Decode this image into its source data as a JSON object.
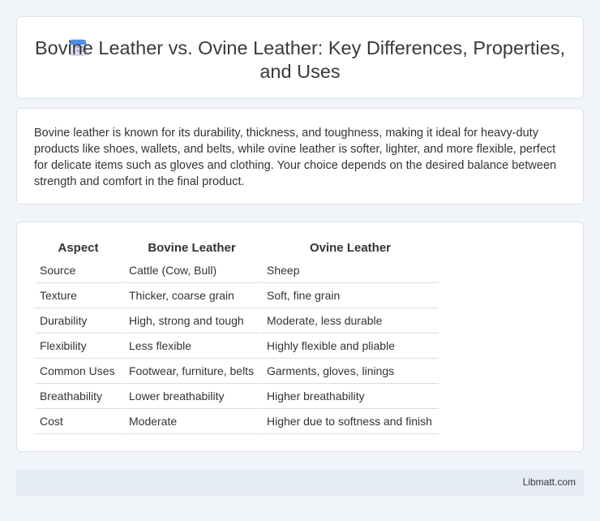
{
  "header": {
    "title": "Bovine Leather vs. Ovine Leather: Key Differences, Properties, and Uses",
    "icon": "calendar-icon"
  },
  "summary": {
    "text": "Bovine leather is known for its durability, thickness, and toughness, making it ideal for heavy-duty products like shoes, wallets, and belts, while ovine leather is softer, lighter, and more flexible, perfect for delicate items such as gloves and clothing. Your choice depends on the desired balance between strength and comfort in the final product."
  },
  "table": {
    "headers": [
      "Aspect",
      "Bovine Leather",
      "Ovine Leather"
    ],
    "rows": [
      [
        "Source",
        "Cattle (Cow, Bull)",
        "Sheep"
      ],
      [
        "Texture",
        "Thicker, coarse grain",
        "Soft, fine grain"
      ],
      [
        "Durability",
        "High, strong and tough",
        "Moderate, less durable"
      ],
      [
        "Flexibility",
        "Less flexible",
        "Highly flexible and pliable"
      ],
      [
        "Common Uses",
        "Footwear, furniture, belts",
        "Garments, gloves, linings"
      ],
      [
        "Breathability",
        "Lower breathability",
        "Higher breathability"
      ],
      [
        "Cost",
        "Moderate",
        "Higher due to softness and finish"
      ]
    ]
  },
  "footer": {
    "text": "Libmatt.com"
  },
  "colors": {
    "background": "#f1f4f8",
    "footer_bg": "#e6ecf5",
    "icon_blue": "#4a8fe7"
  }
}
